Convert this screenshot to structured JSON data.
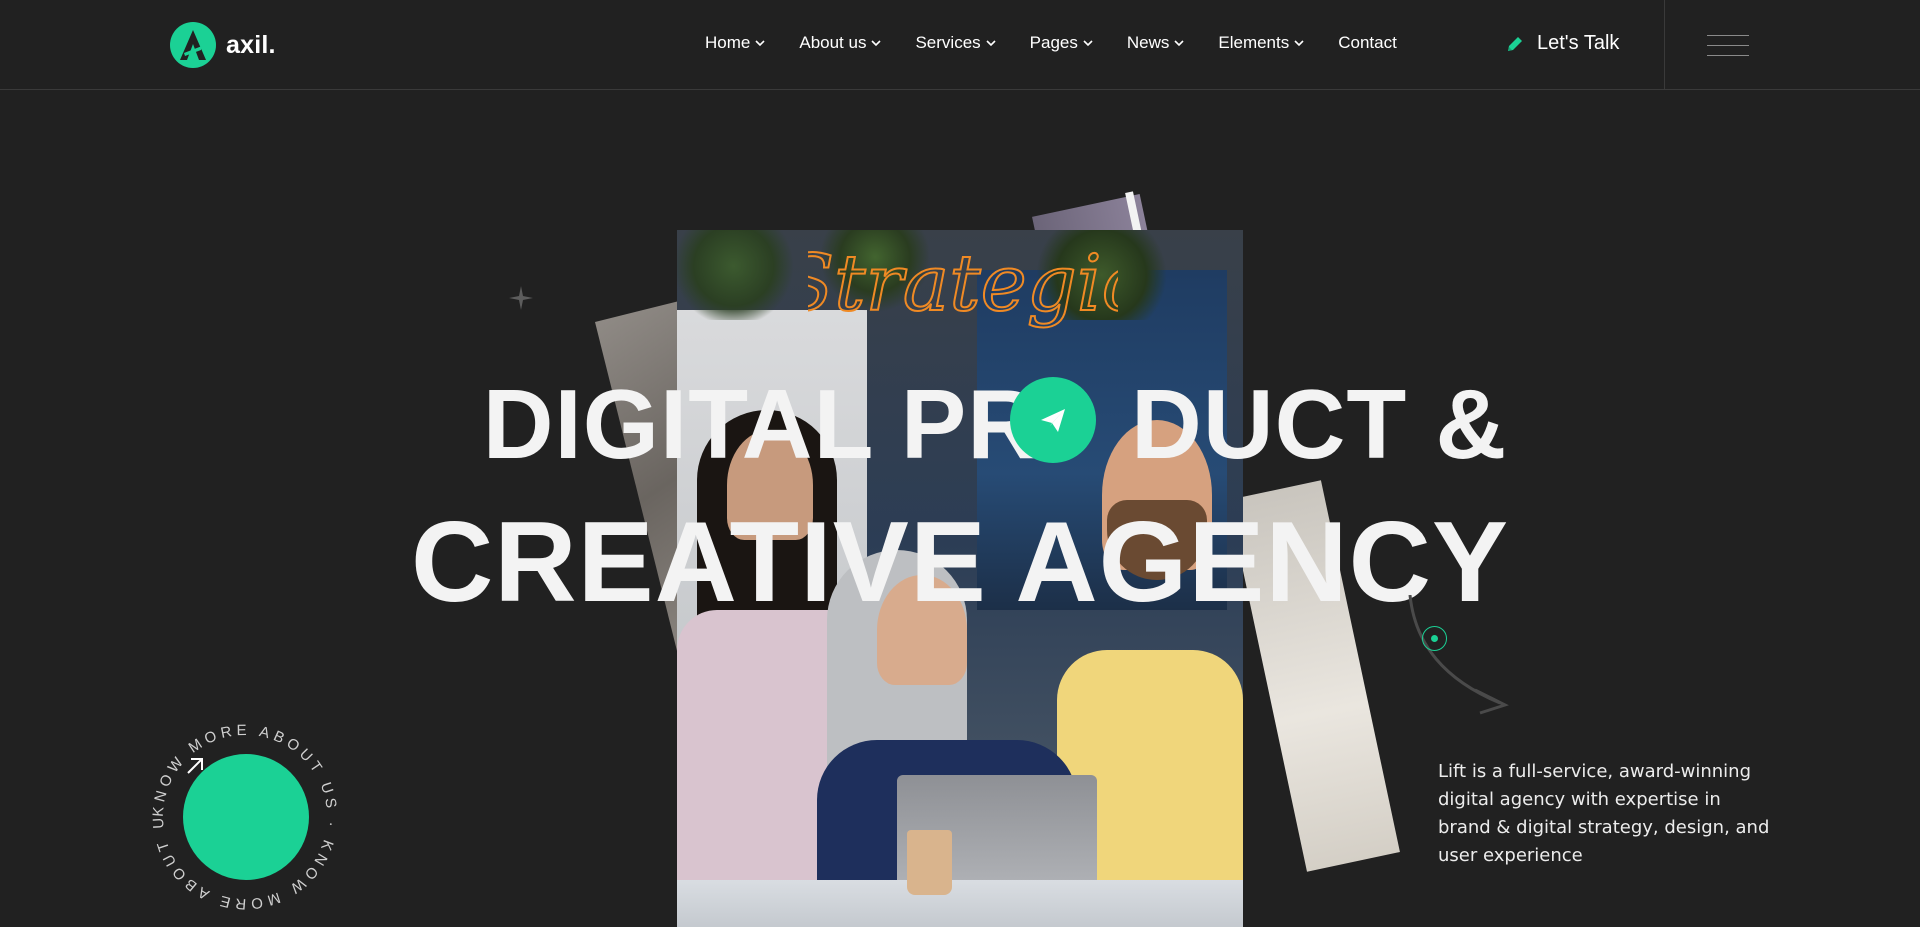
{
  "brand": {
    "name": "axil.",
    "accent": "#1bd195"
  },
  "nav": {
    "items": [
      {
        "label": "Home",
        "has_dropdown": true
      },
      {
        "label": "About us",
        "has_dropdown": true
      },
      {
        "label": "Services",
        "has_dropdown": true
      },
      {
        "label": "Pages",
        "has_dropdown": true
      },
      {
        "label": "News",
        "has_dropdown": true
      },
      {
        "label": "Elements",
        "has_dropdown": true
      },
      {
        "label": "Contact",
        "has_dropdown": false
      }
    ],
    "cta_label": "Let's Talk"
  },
  "hero": {
    "script_word": "Strategic",
    "line1_a": "DIGITAL PR",
    "line1_b": "DUCT &",
    "line2": "CREATIVE AGENCY",
    "description": "Lift is a full-service, award-winning digital agency with expertise in brand & digital strategy, design, and user experience",
    "circle_text": "KNOW MORE ABOUT US · KNOW MORE ABOUT US · "
  },
  "colors": {
    "background": "#212121",
    "script": "#f08a24"
  }
}
